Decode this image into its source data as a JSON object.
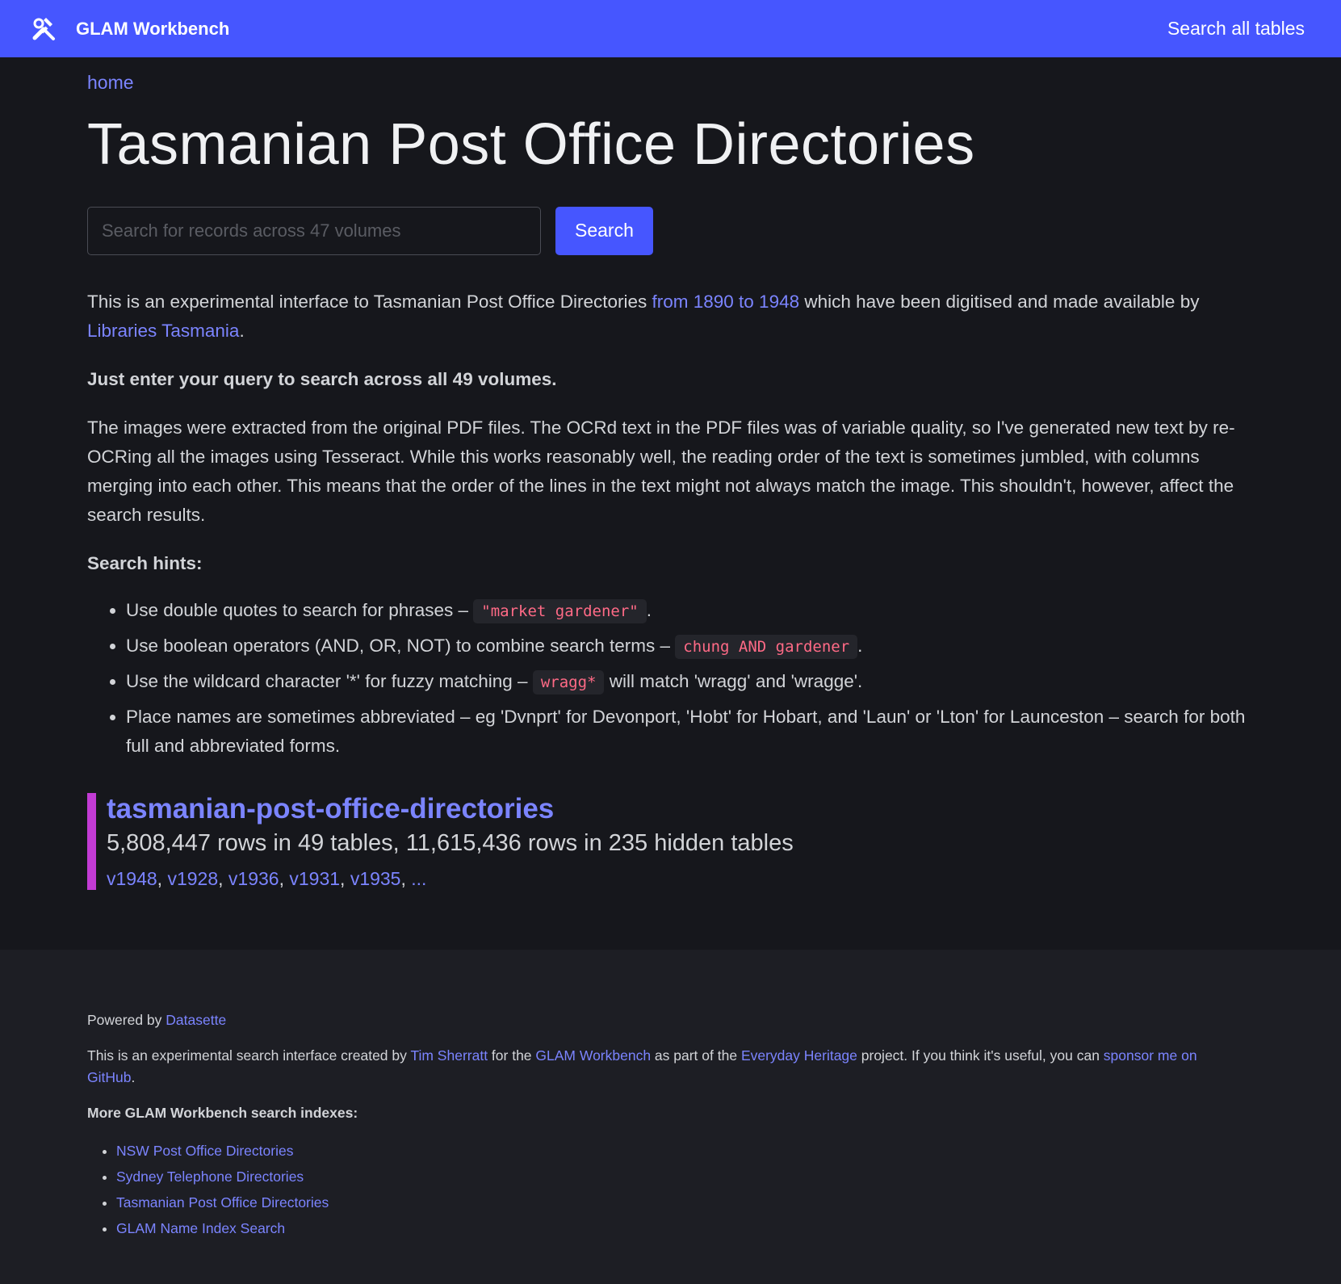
{
  "header": {
    "brand": "GLAM Workbench",
    "search_all_link": "Search all tables"
  },
  "breadcrumb": "home",
  "page_title": "Tasmanian Post Office Directories",
  "search": {
    "placeholder": "Search for records across 47 volumes",
    "button_label": "Search"
  },
  "intro": {
    "text1": "This is an experimental interface to Tasmanian Post Office Directories ",
    "link1": "from 1890 to 1948",
    "text2": " which have been digitised and made available by ",
    "link2": "Libraries Tasmania",
    "text3": "."
  },
  "bold_line": "Just enter your query to search across all 49 volumes.",
  "ocr_paragraph": "The images were extracted from the original PDF files. The OCRd text in the PDF files was of variable quality, so I've generated new text by re-OCRing all the images using Tesseract. While this works reasonably well, the reading order of the text is sometimes jumbled, with columns merging into each other. This means that the order of the lines in the text might not always match the image. This shouldn't, however, affect the search results.",
  "hints_heading": "Search hints:",
  "hints": [
    {
      "before": "Use double quotes to search for phrases – ",
      "code": "\"market gardener\"",
      "after": "."
    },
    {
      "before": "Use boolean operators (AND, OR, NOT) to combine search terms – ",
      "code": "chung AND gardener",
      "after": "."
    },
    {
      "before": "Use the wildcard character '*' for fuzzy matching – ",
      "code": "wragg*",
      "after": " will match 'wragg' and 'wragge'."
    },
    {
      "before": "Place names are sometimes abbreviated – eg 'Dvnprt' for Devonport, 'Hobt' for Hobart, and 'Laun' or 'Lton' for Launceston – search for both full and abbreviated forms.",
      "code": "",
      "after": ""
    }
  ],
  "database": {
    "name": "tasmanian-post-office-directories",
    "stats": "5,808,447 rows in 49 tables, 11,615,436 rows in 235 hidden tables",
    "tables": [
      "v1948",
      "v1928",
      "v1936",
      "v1931",
      "v1935",
      "..."
    ]
  },
  "footer": {
    "powered_by": "Powered by ",
    "datasette": "Datasette",
    "about": {
      "t1": "This is an experimental search interface created by ",
      "l1": "Tim Sherratt",
      "t2": " for the ",
      "l2": "GLAM Workbench",
      "t3": " as part of the ",
      "l3": "Everyday Heritage",
      "t4": " project. If you think it's useful, you can ",
      "l4": "sponsor me on GitHub",
      "t5": "."
    },
    "more_heading": "More GLAM Workbench search indexes:",
    "more_links": [
      "NSW Post Office Directories",
      "Sydney Telephone Directories",
      "Tasmanian Post Office Directories",
      "GLAM Name Index Search"
    ]
  },
  "colors": {
    "accent": "#4656ff",
    "link": "#7b84ff",
    "background": "#16171c",
    "code_text": "#ff6a86",
    "db_bar": "#c23bd4"
  }
}
